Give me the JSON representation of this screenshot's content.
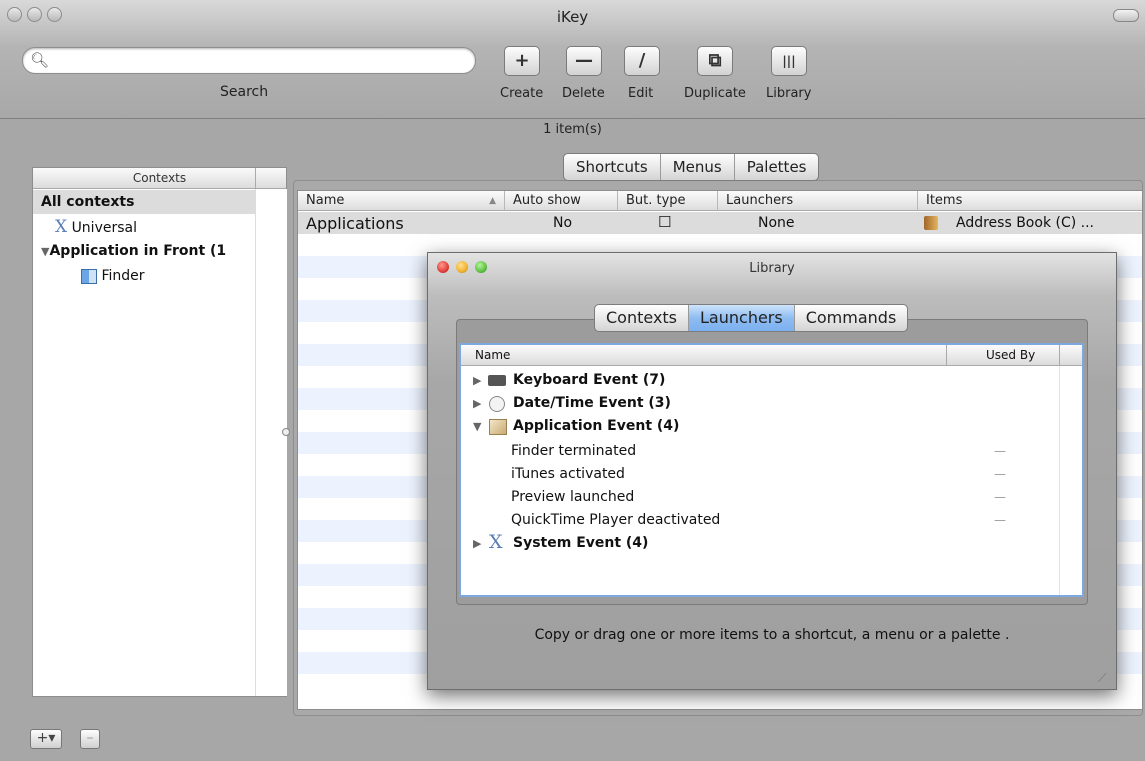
{
  "window": {
    "title": "iKey"
  },
  "search": {
    "placeholder": "",
    "label": "Search"
  },
  "toolbar": [
    {
      "label": "Create",
      "glyph": "+"
    },
    {
      "label": "Delete",
      "glyph": "—"
    },
    {
      "label": "Edit",
      "glyph": "/"
    },
    {
      "label": "Duplicate",
      "glyph": "⧉"
    },
    {
      "label": "Library",
      "glyph": "|||"
    }
  ],
  "item_count": "1 item(s)",
  "contexts": {
    "header": "Contexts",
    "items": [
      {
        "label": "All contexts"
      },
      {
        "label": "Universal",
        "icon": "x-icon"
      },
      {
        "label": "Application in Front (1",
        "icon": "disclosure-open-icon"
      },
      {
        "label": "Finder",
        "icon": "finder-icon"
      }
    ]
  },
  "main_tabs": [
    "Shortcuts",
    "Menus",
    "Palettes"
  ],
  "table": {
    "columns": [
      "Name",
      "Auto show",
      "But. type",
      "Launchers",
      "Items"
    ],
    "rows": [
      {
        "name": "Applications",
        "auto_show": "No",
        "but_type": "☐",
        "launchers": "None",
        "items": "Address Book (C) ..."
      }
    ]
  },
  "library": {
    "title": "Library",
    "tabs": [
      "Contexts",
      "Launchers",
      "Commands"
    ],
    "active_tab": "Launchers",
    "columns": [
      "Name",
      "Used By"
    ],
    "groups": [
      {
        "label": "Keyboard Event (7)",
        "expanded": false,
        "icon": "keyboard-icon"
      },
      {
        "label": "Date/Time Event (3)",
        "expanded": false,
        "icon": "clock-icon"
      },
      {
        "label": "Application Event (4)",
        "expanded": true,
        "icon": "application-icon",
        "children": [
          {
            "label": "Finder terminated",
            "used_by": "—"
          },
          {
            "label": "iTunes activated",
            "used_by": "—"
          },
          {
            "label": "Preview launched",
            "used_by": "—"
          },
          {
            "label": "QuickTime Player deactivated",
            "used_by": "—"
          }
        ]
      },
      {
        "label": "System Event (4)",
        "expanded": false,
        "icon": "x-icon"
      }
    ],
    "hint": "Copy or drag one or more items to a shortcut, a menu or a palette ."
  },
  "bottom": {
    "add": "+▾",
    "remove": "–"
  },
  "colors": {
    "selection": "#7bb0ef",
    "stripe": "#edf3fe",
    "close": "#e2403c",
    "minimize": "#f0b230",
    "zoom": "#5fc144"
  }
}
